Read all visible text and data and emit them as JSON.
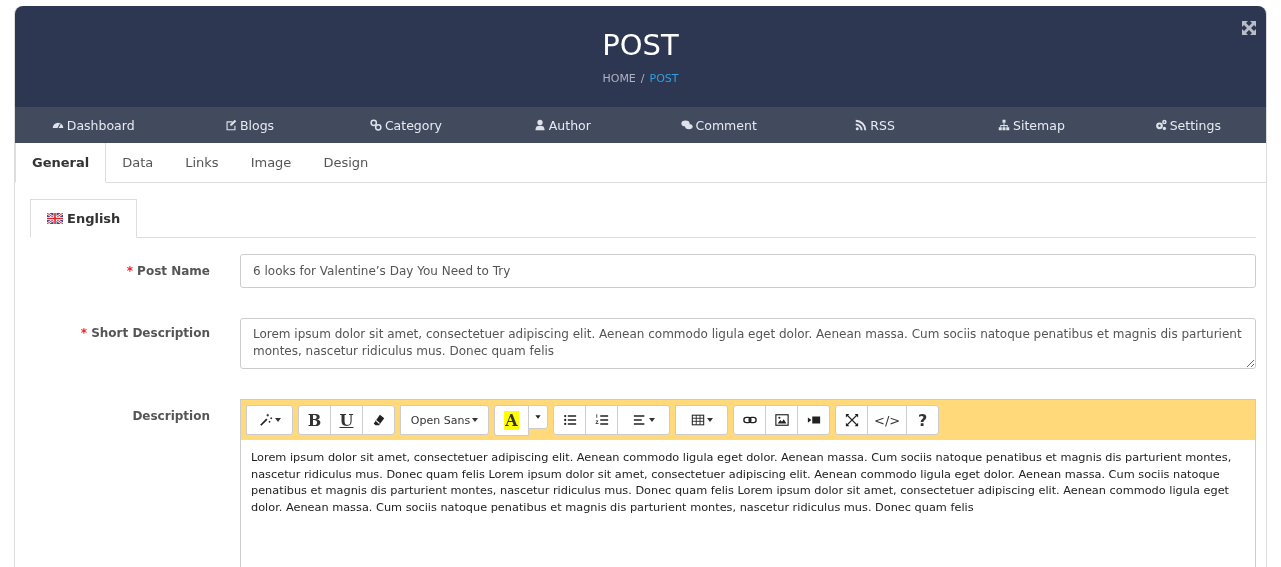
{
  "header": {
    "title": "POST",
    "separator": "/",
    "breadcrumb": [
      {
        "label": "HOME",
        "selected": false
      },
      {
        "label": "POST",
        "selected": true
      }
    ]
  },
  "nav": [
    {
      "label": "Dashboard",
      "kind": "dashboard"
    },
    {
      "label": "Blogs",
      "kind": "edit"
    },
    {
      "label": "Category",
      "kind": "link"
    },
    {
      "label": "Author",
      "kind": "user"
    },
    {
      "label": "Comment",
      "kind": "comment"
    },
    {
      "label": "RSS",
      "kind": "rss"
    },
    {
      "label": "Sitemap",
      "kind": "sitemap"
    },
    {
      "label": "Settings",
      "kind": "gears"
    }
  ],
  "tabs": [
    {
      "label": "General",
      "selected": true
    },
    {
      "label": "Data",
      "selected": false
    },
    {
      "label": "Links",
      "selected": false
    },
    {
      "label": "Image",
      "selected": false
    },
    {
      "label": "Design",
      "selected": false
    }
  ],
  "language_tabs": [
    {
      "label": "English",
      "selected": true
    }
  ],
  "form": {
    "post_name": {
      "label": "Post Name",
      "required_mark": "*",
      "value": "6 looks for Valentine’s Day You Need to Try"
    },
    "short_description": {
      "label": "Short Description",
      "required_mark": "*",
      "value": "Lorem ipsum dolor sit amet, consectetuer adipiscing elit. Aenean commodo ligula eget dolor. Aenean massa. Cum sociis natoque penatibus et magnis dis parturient montes, nascetur ridiculus mus. Donec quam felis"
    },
    "description": {
      "label": "Description",
      "value": "Lorem ipsum dolor sit amet, consectetuer adipiscing elit. Aenean commodo ligula eget dolor. Aenean massa. Cum sociis natoque penatibus et magnis dis parturient montes, nascetur ridiculus mus. Donec quam felis Lorem ipsum dolor sit amet, consectetuer adipiscing elit. Aenean commodo ligula eget dolor. Aenean massa. Cum sociis natoque penatibus et magnis dis parturient montes, nascetur ridiculus mus. Donec quam felis Lorem ipsum dolor sit amet, consectetuer adipiscing elit. Aenean commodo ligula eget dolor. Aenean massa. Cum sociis natoque penatibus et magnis dis parturient montes, nascetur ridiculus mus. Donec quam felis"
    },
    "toolbar": [
      [
        {
          "kind": "magic"
        }
      ],
      [
        {
          "kind": "bold",
          "label": "B"
        },
        {
          "kind": "underline",
          "label": "U"
        },
        {
          "kind": "eraser"
        }
      ],
      [
        {
          "kind": "font",
          "label": "Open Sans"
        }
      ],
      [
        {
          "kind": "color",
          "label": "A"
        },
        {
          "kind": "caret"
        }
      ],
      [
        {
          "kind": "ul"
        },
        {
          "kind": "ol"
        },
        {
          "kind": "align"
        }
      ],
      [
        {
          "kind": "table"
        }
      ],
      [
        {
          "kind": "link"
        },
        {
          "kind": "image"
        },
        {
          "kind": "video"
        }
      ],
      [
        {
          "kind": "fullscreen"
        },
        {
          "kind": "code",
          "label": "</>"
        },
        {
          "kind": "help",
          "label": "?"
        }
      ]
    ]
  }
}
